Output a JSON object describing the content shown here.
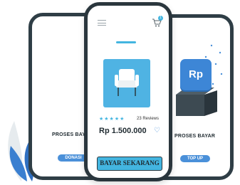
{
  "left_card": {
    "title": "PROSES BAYAR",
    "button_label": "DONASI"
  },
  "right_card": {
    "title": "PROSES BAYAR",
    "button_label": "TOP UP",
    "badge_text": "Rp"
  },
  "center_card": {
    "rating_stars": 5,
    "reviews_text": "23 Reviews",
    "price": "Rp 1.500.000",
    "pay_button_label": "BAYAR SEKARANG",
    "cart_count": "1"
  },
  "colors": {
    "accent": "#4a90d9",
    "dark": "#2f3e46",
    "pay_button": "#43b5e0",
    "product_bg": "#4fb3e3"
  }
}
